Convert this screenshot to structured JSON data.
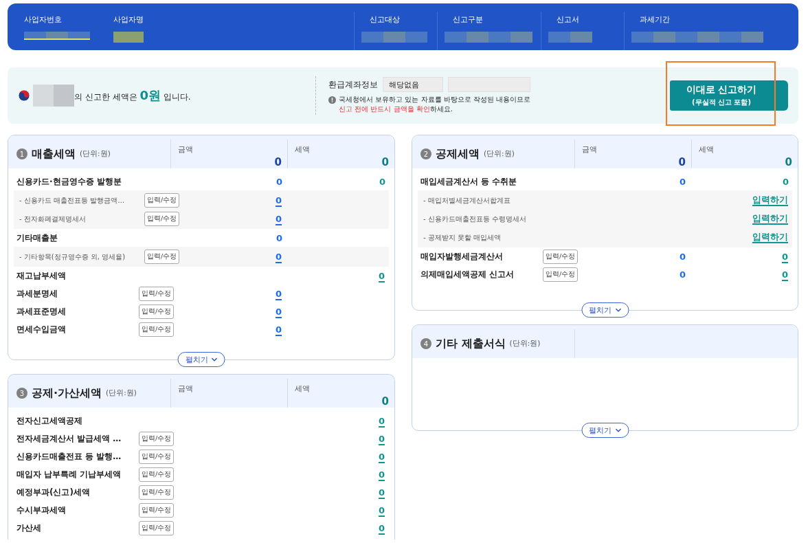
{
  "header": {
    "fields": [
      {
        "label": "사업자번호"
      },
      {
        "label": "사업자명"
      },
      {
        "label": "신고대상"
      },
      {
        "label": "신고구분"
      },
      {
        "label": "신고서"
      },
      {
        "label": "과세기간"
      }
    ]
  },
  "notice": {
    "text_before": "의 신고한 세액은 ",
    "amount": "0원",
    "text_after": " 입니다.",
    "refund_label": "환급계좌정보",
    "refund_value": "해당없음",
    "note_line": "국세청에서 보유하고 있는 자료를 바탕으로 작성된 내용이므로",
    "note_warning": "신고 전에 반드시 금액을 확인",
    "note_tail": "하세요.",
    "submit_title": "이대로 신고하기",
    "submit_sub": "(무실적 신고 포함)"
  },
  "columns": [
    {
      "sections": [
        {
          "number": "1",
          "title": "매출세액",
          "unit": "(단위:원)",
          "cols": [
            {
              "label": "금액",
              "value": "0"
            },
            {
              "label": "세액",
              "value": "0"
            }
          ],
          "expand": "펼치기",
          "rows": [
            {
              "kind": "main",
              "label": "신용카드·현금영수증 발행분",
              "amount": {
                "text": "0",
                "link": false
              },
              "tax": {
                "text": "0",
                "link": false
              }
            },
            {
              "kind": "group",
              "items": [
                {
                  "label": "- 신용카드 매출전표등 발행금액…",
                  "button": "입력/수정",
                  "amount": {
                    "text": "0",
                    "link": true
                  }
                },
                {
                  "label": "- 전자화폐결제명세서",
                  "button": "입력/수정",
                  "amount": {
                    "text": "0",
                    "link": true
                  }
                }
              ]
            },
            {
              "kind": "main",
              "label": "기타매출분",
              "amount": {
                "text": "0",
                "link": false
              }
            },
            {
              "kind": "group",
              "items": [
                {
                  "label": "- 기타항목(정규영수증 외, 영세율)",
                  "button": "입력/수정",
                  "amount": {
                    "text": "0",
                    "link": true
                  }
                }
              ]
            },
            {
              "kind": "main",
              "label": "재고납부세액",
              "tax": {
                "text": "0",
                "link": true
              }
            },
            {
              "kind": "main",
              "label": "과세분명세",
              "button": "입력/수정",
              "amount": {
                "text": "0",
                "link": true
              }
            },
            {
              "kind": "main",
              "label": "과세표준명세",
              "button": "입력/수정",
              "amount": {
                "text": "0",
                "link": true
              }
            },
            {
              "kind": "main",
              "label": "면세수입금액",
              "button": "입력/수정",
              "amount": {
                "text": "0",
                "link": true
              }
            }
          ]
        },
        {
          "number": "3",
          "title": "공제·가산세액",
          "unit": "(단위:원)",
          "cols": [
            {
              "label": "금액"
            },
            {
              "label": "세액",
              "value": "0"
            }
          ],
          "rows": [
            {
              "kind": "main",
              "label": "전자신고세액공제",
              "tax": {
                "text": "0",
                "link": true
              }
            },
            {
              "kind": "main",
              "label": "전자세금계산서 발급세액 …",
              "button": "입력/수정",
              "tax": {
                "text": "0",
                "link": true
              }
            },
            {
              "kind": "main",
              "label": "신용카드매출전표 등 발행…",
              "button": "입력/수정",
              "tax": {
                "text": "0",
                "link": true
              }
            },
            {
              "kind": "main",
              "label": "매입자 납부특례 기납부세액",
              "button": "입력/수정",
              "tax": {
                "text": "0",
                "link": true
              }
            },
            {
              "kind": "main",
              "label": "예정부과(신고)세액",
              "button": "입력/수정",
              "tax": {
                "text": "0",
                "link": true
              }
            },
            {
              "kind": "main",
              "label": "수시부과세액",
              "button": "입력/수정",
              "tax": {
                "text": "0",
                "link": true
              }
            },
            {
              "kind": "main",
              "label": "가산세",
              "button": "입력/수정",
              "tax": {
                "text": "0",
                "link": true
              }
            }
          ]
        }
      ]
    },
    {
      "sections": [
        {
          "number": "2",
          "title": "공제세액",
          "unit": "(단위:원)",
          "cols": [
            {
              "label": "금액",
              "value": "0"
            },
            {
              "label": "세액",
              "value": "0"
            }
          ],
          "expand": "펼치기",
          "rows": [
            {
              "kind": "main",
              "label": "매입세금계산서 등 수취분",
              "amount": {
                "text": "0",
                "link": false
              },
              "tax": {
                "text": "0",
                "link": false
              }
            },
            {
              "kind": "group",
              "items": [
                {
                  "label": "- 매입처별세금계산서합계표",
                  "tax": {
                    "text": "입력하기",
                    "link": true
                  }
                },
                {
                  "label": "- 신용카드매출전표등 수령명세서",
                  "tax": {
                    "text": "입력하기",
                    "link": true
                  }
                },
                {
                  "label": "- 공제받지 못할 매입세액",
                  "tax": {
                    "text": "입력하기",
                    "link": true
                  }
                }
              ]
            },
            {
              "kind": "main",
              "label": "매입자발행세금계산서",
              "button": "입력/수정",
              "amount": {
                "text": "0",
                "link": false
              },
              "tax": {
                "text": "0",
                "link": true
              }
            },
            {
              "kind": "main",
              "label": "의제매입세액공제 신고서",
              "button": "입력/수정",
              "amount": {
                "text": "0",
                "link": false
              },
              "tax": {
                "text": "0",
                "link": true
              }
            }
          ]
        },
        {
          "number": "4",
          "title": "기타 제출서식",
          "unit": "(단위:원)",
          "expand": "펼치기"
        }
      ]
    }
  ]
}
